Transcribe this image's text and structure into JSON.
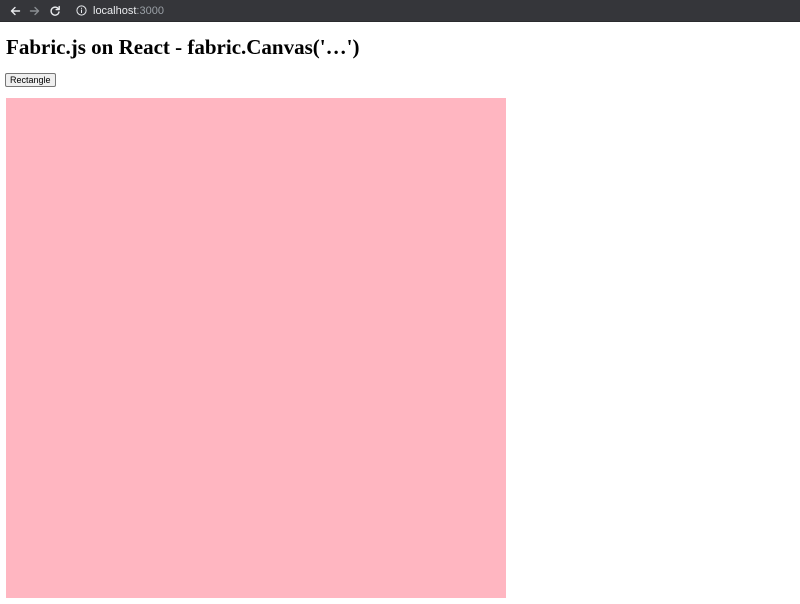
{
  "browser": {
    "url_host": "localhost",
    "url_port": ":3000",
    "icons": [
      "back-arrow-icon",
      "forward-arrow-icon",
      "reload-icon",
      "info-icon"
    ]
  },
  "page": {
    "title": "Fabric.js on React - fabric.Canvas('…')",
    "rectangle_button_label": "Rectangle"
  },
  "canvas": {
    "background_color": "#ffb6c1"
  },
  "colors": {
    "toolbar": "#35363a",
    "canvas_pink": "#ffb6c1"
  }
}
